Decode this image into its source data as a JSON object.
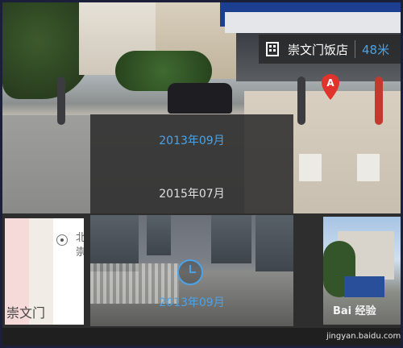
{
  "hotel": {
    "name": "崇文门饭店",
    "distance": "48米",
    "icon": "building-icon"
  },
  "marker": {
    "label": "A",
    "color": "#e0332b"
  },
  "timeline": {
    "selected_date": "2013年09月",
    "other_date": "2015年07月",
    "accent": "#4aa3e8"
  },
  "thumbnails": {
    "map": {
      "place": "崇文门",
      "side_text": "北崇"
    },
    "pano": {
      "date": "2013年09月",
      "icon": "clock-icon"
    }
  },
  "watermark": {
    "text": "Bai 经验",
    "url": "jingyan.baidu.com"
  }
}
